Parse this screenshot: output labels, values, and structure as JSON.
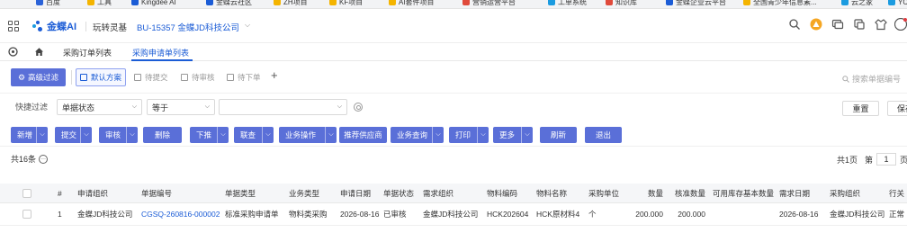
{
  "bookmarks": [
    {
      "label": "百度",
      "color": "#2a62d8"
    },
    {
      "label": "工具",
      "color": "#f4b400"
    },
    {
      "label": "Kingdee AI",
      "color": "#1b5cd6"
    },
    {
      "label": "金蝶云社区",
      "color": "#1b5cd6"
    },
    {
      "label": "ZH项目",
      "color": "#f4b400"
    },
    {
      "label": "KF项目",
      "color": "#f4b400"
    },
    {
      "label": "AI套件项目",
      "color": "#f4b400"
    },
    {
      "label": "营销运营平台",
      "color": "#e04a3b"
    },
    {
      "label": "工单系统",
      "color": "#1b9be0"
    },
    {
      "label": "知识库",
      "color": "#e04a3b"
    },
    {
      "label": "金蝶企业云平台",
      "color": "#1b5cd6"
    },
    {
      "label": "全国青少年信息素...",
      "color": "#f4b400"
    },
    {
      "label": "云之家",
      "color": "#1b9be0"
    },
    {
      "label": "YC",
      "color": "#1b9be0"
    }
  ],
  "header": {
    "logo_text": "金蝶AI",
    "play": "玩转灵基",
    "org": "BU-15357 金蝶JD科技公司"
  },
  "nav": {
    "tabs": [
      {
        "label": "采购订单列表",
        "active": false
      },
      {
        "label": "采购申请单列表",
        "active": true
      }
    ]
  },
  "scheme": {
    "advanced_filter": "高级过滤",
    "tabs": [
      "默认方案",
      "待提交",
      "待审核",
      "待下单"
    ],
    "search_placeholder": "搜索单据编号"
  },
  "quick_filter": {
    "label": "快捷过滤",
    "field": "单据状态",
    "operator": "等于",
    "value": "",
    "reset": "重置",
    "save": "保存"
  },
  "toolbar": [
    {
      "label": "新增",
      "dropdown": true
    },
    {
      "label": "提交",
      "dropdown": true
    },
    {
      "label": "审核",
      "dropdown": true
    },
    {
      "label": "删除",
      "dropdown": false
    },
    {
      "label": "下推",
      "dropdown": true
    },
    {
      "label": "联查",
      "dropdown": true
    },
    {
      "label": "业务操作",
      "dropdown": true
    },
    {
      "label": "推荐供应商",
      "dropdown": false
    },
    {
      "label": "业务查询",
      "dropdown": true
    },
    {
      "label": "打印",
      "dropdown": true
    },
    {
      "label": "更多",
      "dropdown": true
    },
    {
      "label": "刷新",
      "dropdown": false
    },
    {
      "label": "退出",
      "dropdown": false
    }
  ],
  "list_meta": {
    "count_text": "共16条",
    "pages_text": "共1页",
    "page_prefix": "第",
    "page_value": "1",
    "page_suffix": "页"
  },
  "table": {
    "columns": [
      "#",
      "申请组织",
      "单据编号",
      "单据类型",
      "业务类型",
      "申请日期",
      "单据状态",
      "需求组织",
      "物料编码",
      "物料名称",
      "采购单位",
      "数量",
      "核准数量",
      "可用库存基本数量",
      "需求日期",
      "采购组织",
      "行关"
    ],
    "rows": [
      [
        "1",
        "金蝶JD科技公司",
        "CGSQ-260816-000002",
        "标准采购申请单",
        "物料类采购",
        "2026-08-16",
        "已审核",
        "金蝶JD科技公司",
        "HCK202604",
        "HCK原材料4",
        "个",
        "200.000",
        "200.000",
        "",
        "2026-08-16",
        "金蝶JD科技公司",
        "正常"
      ]
    ]
  },
  "colors": {
    "primary": "#5a6fd8",
    "link": "#1b5cd6"
  }
}
